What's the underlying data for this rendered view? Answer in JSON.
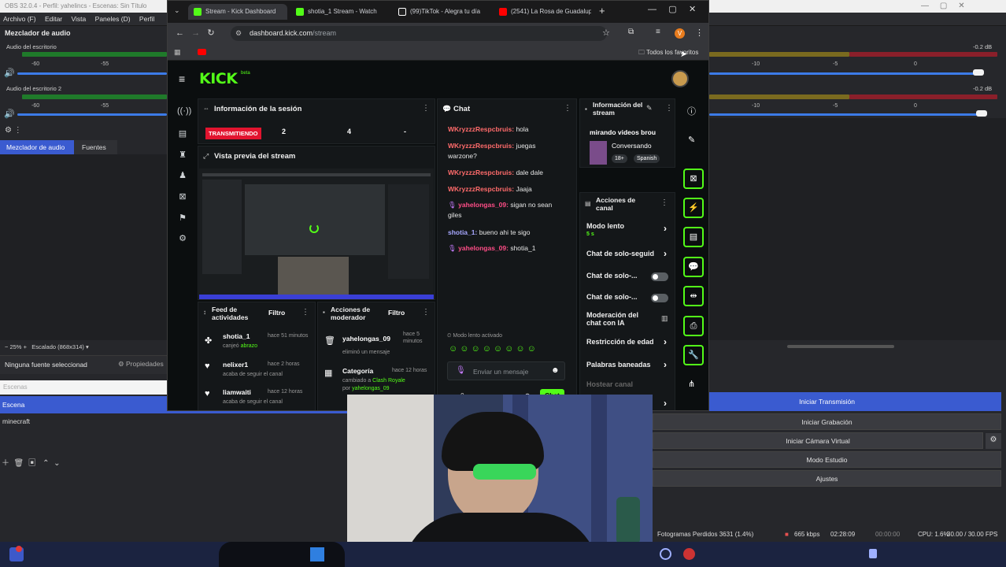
{
  "obs": {
    "title": "OBS 32.0.4 - Perfil: yahelincs - Escenas: Sin Título",
    "menu": [
      "Archivo (F)",
      "Editar",
      "Vista",
      "Paneles (D)",
      "Perfil"
    ],
    "mixer_title": "Mezclador de audio",
    "tracks": [
      {
        "name": "Audio del escritorio",
        "db": "-0.2 dB"
      },
      {
        "name": "Audio del escritorio 2",
        "db": "-0.2 dB"
      }
    ],
    "scale_ticks": [
      "-60",
      "-55",
      "-50",
      "-45",
      "-40",
      "-35",
      "-30",
      "-25",
      "-20",
      "-15",
      "-10",
      "-5",
      "0"
    ],
    "tabs": [
      "Mezclador de audio",
      "Fuentes"
    ],
    "zoom": "25%",
    "scaled": "Escalado (868x314)",
    "no_source": "Ninguna fuente seleccionad",
    "properties": "Propiedades",
    "scenes_label": "Escenas",
    "scene_header": "Escena",
    "scenes": [
      "minecraft"
    ],
    "controls": [
      "Iniciar Transmisión",
      "Iniciar Grabación",
      "Iniciar Cámara Virtual",
      "Modo Estudio",
      "Ajustes"
    ],
    "status": {
      "dropped": "Fotogramas Perdidos 3631 (1.4%)",
      "bitrate": "665 kbps",
      "stream_time": "02:28:09",
      "rec_time": "00:00:00",
      "cpu": "CPU: 1.6%",
      "fps": "30.00 / 30.00 FPS"
    }
  },
  "browser": {
    "tabs": [
      {
        "label": "Stream - Kick Dashboard",
        "color": "#53fc18"
      },
      {
        "label": "shotia_1 Stream - Watch",
        "color": "#53fc18"
      },
      {
        "label": "(99)TikTok - Alegra tu día",
        "color": "#ffffff"
      },
      {
        "label": "(2541) La Rosa de Guadalupe",
        "color": "#ff0000"
      }
    ],
    "url_domain": "dashboard.kick.com",
    "url_path": "/stream",
    "bookmarks_label": "Todos los favoritos",
    "profile_letter": "V"
  },
  "kick": {
    "logo": "KICK",
    "logo_badge": "beta",
    "session": {
      "title": "Información de la sesión",
      "live_badge": "TRANSMITIENDO",
      "stat1": "2",
      "stat2": "4",
      "stat3": "-"
    },
    "preview_title": "Vista previa del stream",
    "chat": {
      "title": "Chat",
      "messages": [
        {
          "user": "WKryzzzRespcbruis:",
          "text": "hola"
        },
        {
          "user": "WKryzzzRespcbruis:",
          "text": "juegas warzone?"
        },
        {
          "user": "WKryzzzRespcbruis:",
          "text": "dale dale"
        },
        {
          "user": "WKryzzzRespcbruis:",
          "text": "Jaaja"
        },
        {
          "user": "yahelongas_09:",
          "text": "sigan no sean giles"
        },
        {
          "user": "shotia_1:",
          "text": "bueno ahi te sigo"
        },
        {
          "user": "yahelongas_09:",
          "text": "shotia_1"
        }
      ],
      "slow_mode": "Modo lento activado",
      "placeholder": "Enviar un mensaje",
      "count": "0",
      "send": "Chat"
    },
    "stream_info": {
      "title": "Información del stream",
      "stream_title": "mirando videos brou",
      "category": "Conversando",
      "tag1": "18+",
      "tag2": "Spanish"
    },
    "channel_actions": {
      "title": "Acciones de canal",
      "items": [
        {
          "label": "Modo lento",
          "sub": "5 s"
        },
        {
          "label": "Chat de solo-seguid"
        },
        {
          "label": "Chat de solo-..."
        },
        {
          "label": "Chat de solo-..."
        },
        {
          "label": "Moderación del chat con IA"
        },
        {
          "label": "Restricción de edad"
        },
        {
          "label": "Palabras baneadas"
        },
        {
          "label": "Hostear canal"
        }
      ]
    },
    "feed": {
      "title": "Feed de actividades",
      "filter": "Filtro",
      "items": [
        {
          "user": "shotia_1",
          "time": "hace 51 minutos",
          "text": "canjeó",
          "highlight": "abrazo"
        },
        {
          "user": "nelixer1",
          "time": "hace 2 horas",
          "text": "acaba de seguir el canal"
        },
        {
          "user": "liamwaiti",
          "time": "hace 12 horas",
          "text": "acaba de seguir el canal"
        }
      ]
    },
    "mod_actions": {
      "title": "Acciones de moderador",
      "filter": "Filtro",
      "items": [
        {
          "user": "yahelongas_09",
          "time": "hace 5 minutos",
          "text": "eliminó un mensaje"
        },
        {
          "user": "Categoría",
          "time": "hace 12 horas",
          "text": "cambiado a",
          "highlight": "Clash Royale",
          "by": "por",
          "by_user": "yahelongas_09"
        }
      ]
    }
  }
}
